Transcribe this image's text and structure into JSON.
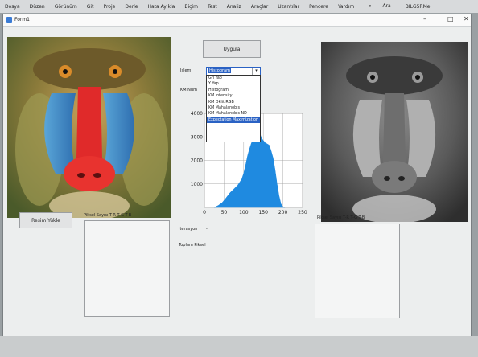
{
  "menu": [
    "Dosya",
    "Düzen",
    "Görünüm",
    "Git",
    "Proje",
    "Derle",
    "Hata Ayıkla",
    "Biçim",
    "Test",
    "Analiz",
    "Araçlar",
    "Uzantılar",
    "Pencere",
    "Yardım"
  ],
  "search": {
    "label": "Ara"
  },
  "project_name": "BILG5RMe",
  "window": {
    "title": "Form1"
  },
  "buttons": {
    "top": "Uygula",
    "load": "Resim Yükle"
  },
  "labels": {
    "islem": "İşlem",
    "km_num": "KM Num",
    "iterasyon": "Iterasyon",
    "iter_value": "-",
    "toplam_piksel": "Toplam Piksel",
    "left_panel_header": "Piksel Sayısı   T-R   T-G   T-B",
    "right_panel_header": "Piksel Sayısı   T-R   T-G   T-B"
  },
  "combo": {
    "selected": "Histogram",
    "options": [
      "Gri Yap",
      "Y Yap",
      "Histogram",
      "KM intensity",
      "KM Öklit RGB",
      "KM Mahalanobis",
      "KM Mahalanobis ND",
      "Expectation Maximization"
    ],
    "highlighted": "Expectation Maximization"
  },
  "chart_data": {
    "type": "area",
    "title": "",
    "xlabel": "",
    "ylabel": "",
    "xlim": [
      0,
      250
    ],
    "ylim": [
      0,
      4000
    ],
    "xticks": [
      0,
      50,
      100,
      150,
      200,
      250
    ],
    "yticks": [
      1000,
      2000,
      3000,
      4000
    ],
    "grid": true,
    "color": "#1f8ae0",
    "x": [
      25,
      35,
      45,
      55,
      65,
      75,
      85,
      95,
      100,
      105,
      110,
      115,
      120,
      125,
      130,
      135,
      140,
      145,
      150,
      155,
      160,
      165,
      170,
      175,
      180,
      185,
      190,
      195,
      200,
      205
    ],
    "values": [
      0,
      80,
      200,
      400,
      620,
      780,
      950,
      1200,
      1450,
      1800,
      2200,
      2500,
      2750,
      2900,
      3200,
      3450,
      3250,
      2950,
      2850,
      2750,
      2700,
      2650,
      2400,
      2100,
      1600,
      1000,
      500,
      150,
      30,
      0
    ]
  },
  "colors": {
    "accent": "#2a62c4",
    "chart_fill": "#1f8ae0"
  }
}
